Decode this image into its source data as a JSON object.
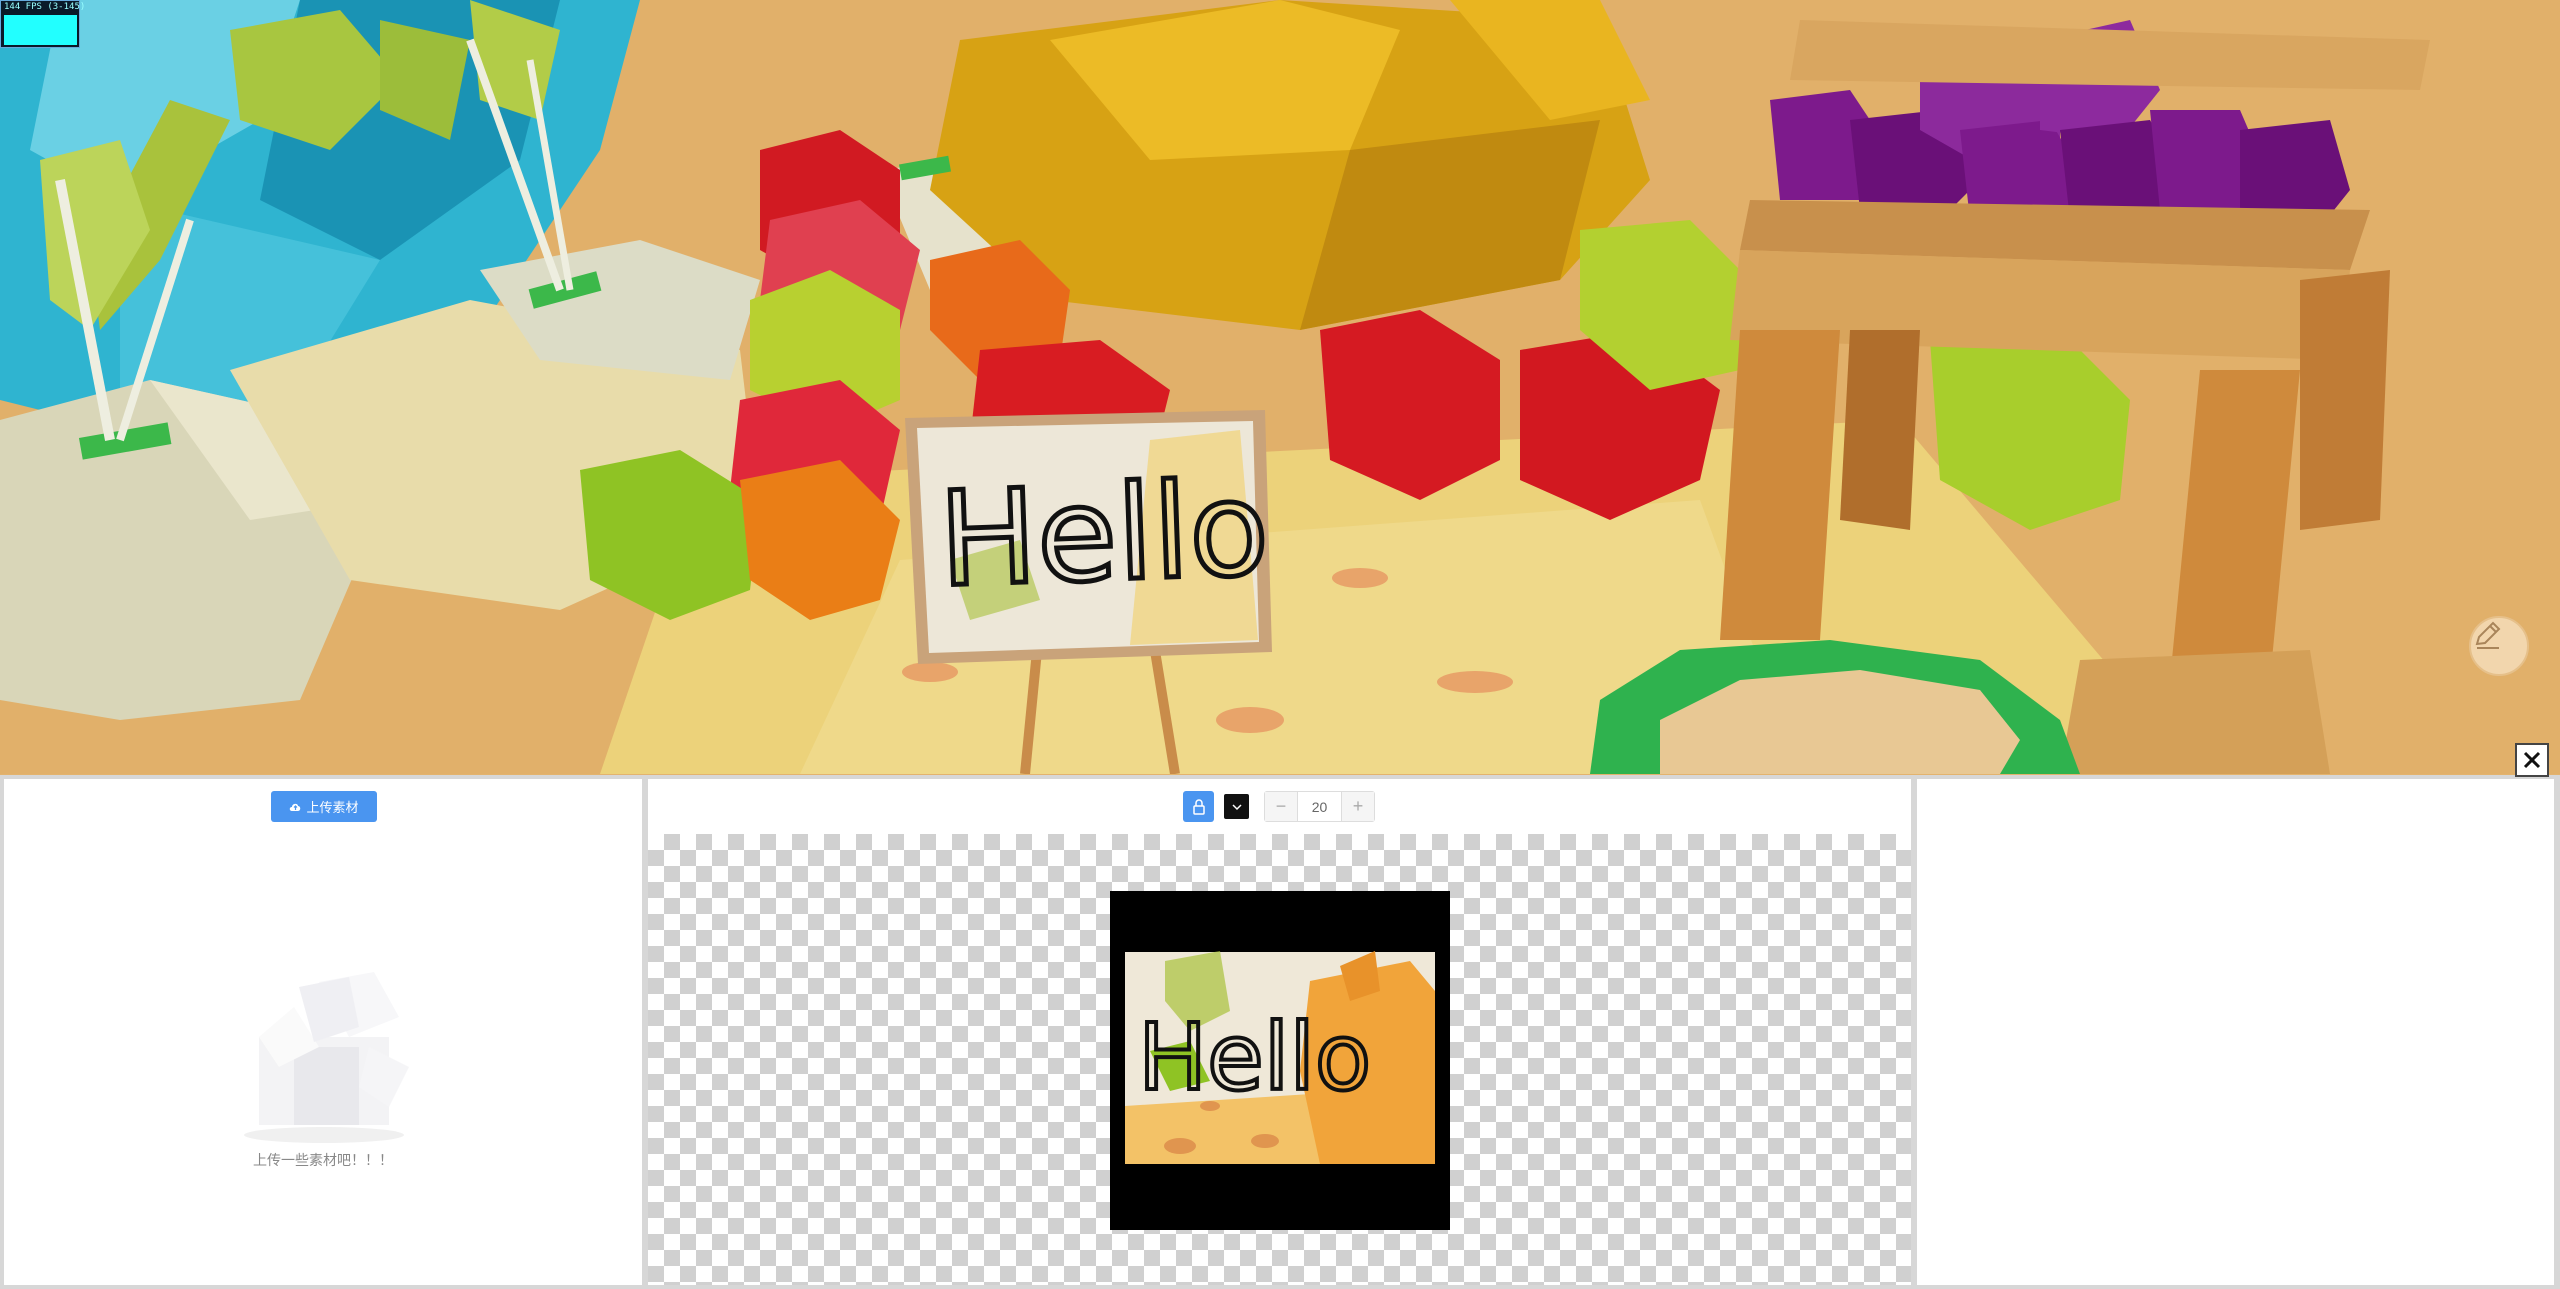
{
  "fps_counter": {
    "text": "144 FPS (3-145)"
  },
  "scene": {
    "sign_text": "Hello",
    "pencil_tool": "pencil-icon",
    "close_icon": "close-icon"
  },
  "left_panel": {
    "upload_button": "上传素材",
    "upload_icon": "cloud-upload-icon",
    "empty_message": "上传一些素材吧！！！"
  },
  "toolbar": {
    "lock_icon": "lock-icon",
    "color_swatch": "#111111",
    "brush_size": "20",
    "decrement_label": "−",
    "increment_label": "+"
  },
  "preview": {
    "text": "Hello"
  },
  "colors": {
    "accent": "#4a95f0",
    "divider": "#d7d7d7"
  }
}
